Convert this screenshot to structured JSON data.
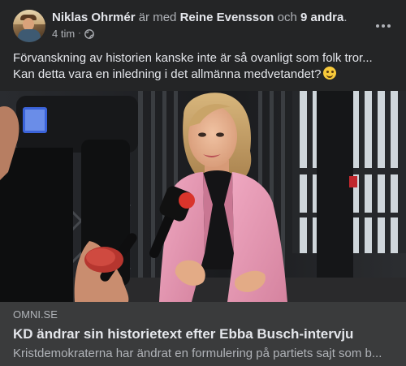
{
  "post": {
    "author": "Niklas Ohrmér",
    "with_text": "är med",
    "tagged": "Reine Evensson",
    "and_text": "och",
    "others": "9 andra",
    "period": ".",
    "time": "4 tim",
    "separator": "·",
    "privacy_icon": "globe-icon",
    "more_icon": "more-horizontal-icon",
    "text_line1": "Förvanskning av historien kanske inte är så ovanligt som folk tror...",
    "text_line2": "Kan detta vara en inledning i det allmänna medvetandet?",
    "emoji": "winking-face-emoji"
  },
  "link": {
    "domain": "OMNI.SE",
    "title": "KD ändrar sin historietext efter Ebba Busch-intervju",
    "description": "Kristdemokraterna har ändrat en formulering på partiets sajt som b..."
  },
  "colors": {
    "background": "#242526",
    "link_box": "#3a3b3c",
    "primary_text": "#e4e6eb",
    "secondary_text": "#b0b3b8",
    "jacket": "#e79bb6",
    "microphone_logo": "#d9342b"
  }
}
